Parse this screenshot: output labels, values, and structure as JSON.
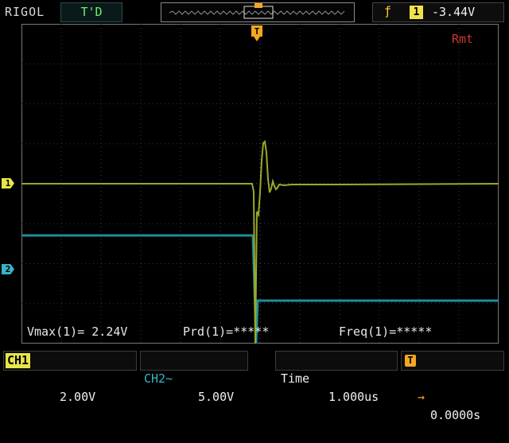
{
  "header": {
    "brand": "RIGOL",
    "status": "T'D",
    "trigger": {
      "edge_icon": "rising-edge-icon",
      "source": "1",
      "level": "-3.44V"
    },
    "remote": "Rmt"
  },
  "markers": {
    "ch1": "1",
    "ch2": "2",
    "trigger": "T"
  },
  "measurements": {
    "vmax": "Vmax(1)= 2.24V",
    "period": "Prd(1)=*****",
    "freq": "Freq(1)=*****"
  },
  "footer": {
    "ch1_label": "CH1",
    "ch1_scale": "2.00V",
    "ch2_label": "CH2~",
    "ch2_scale": "5.00V",
    "time_label": "Time",
    "time_value": "1.000us",
    "trigger_pos_icon": "T",
    "trigger_pos_arrow": "→",
    "trigger_pos_value": "0.0000s"
  },
  "colors": {
    "ch1": "#9aa82a",
    "ch2": "#1f8d9a",
    "grid": "#3a3a3a",
    "trigger": "#f5a623",
    "remote": "#d23232"
  }
}
